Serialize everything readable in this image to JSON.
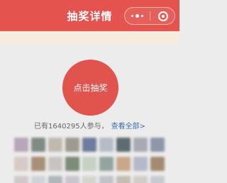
{
  "header": {
    "title": "抽奖详情"
  },
  "capsule": {
    "more_icon": "more-dots-icon",
    "close_icon": "target-close-icon"
  },
  "main": {
    "draw_button_label": "点击抽奖",
    "participants_text": "已有1640295人参与，",
    "view_all_label": "查看全部>"
  },
  "avatar_colors": [
    "#b8a6b9",
    "#7f8c86",
    "#c2b9ad",
    "#9e9a90",
    "#6f7c9e",
    "#b5bcc4",
    "#5d6a70",
    "#a9a9b4",
    "#8e96a8",
    "#d7c9c5",
    "#a88f78",
    "#c8c3c0",
    "#7d8b7a",
    "#c7d0c4",
    "#94a3a0",
    "#c9a78a",
    "#b4b9c9",
    "#a48b72",
    "#cfc9c9",
    "#d0d4d9",
    "#b1b6bb",
    "#c9c5cf",
    "#d4d4d0",
    "#bfc3c8",
    "#c5bdb3",
    "#d2ccc6",
    "#c7cbd1"
  ],
  "colors": {
    "header_bg": "#e4534e",
    "button_bg": "#e0544d",
    "link": "#3f6bb0",
    "page_bg": "#ececec"
  }
}
